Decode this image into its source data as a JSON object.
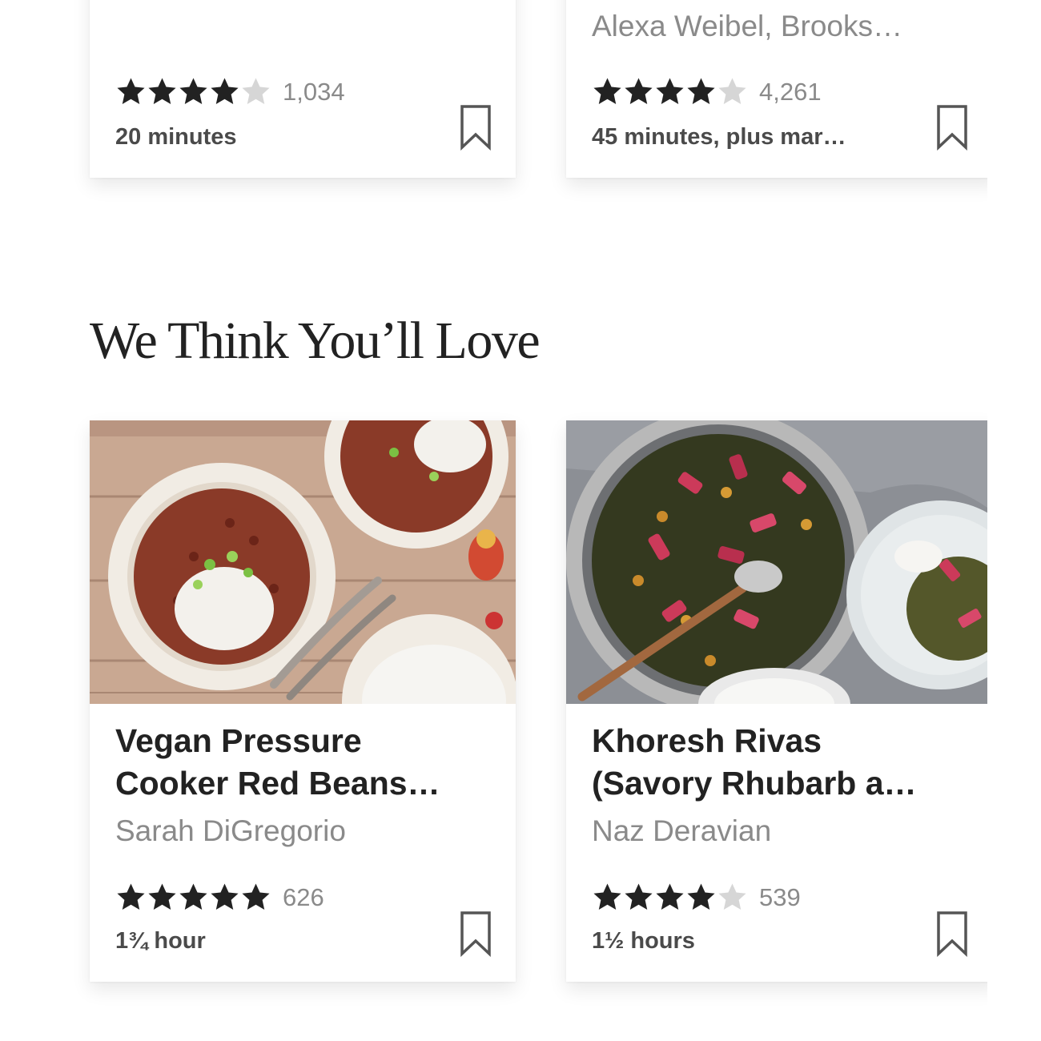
{
  "section": {
    "heading": "We Think You’ll Love"
  },
  "top_cards": [
    {
      "author": "",
      "stars": 4,
      "rating_count": "1,034",
      "time": "20 minutes"
    },
    {
      "author": "Alexa Weibel, Brooks…",
      "stars": 4,
      "rating_count": "4,261",
      "time": "45 minutes, plus mar…"
    }
  ],
  "recipes": [
    {
      "title_line1": "Vegan Pressure",
      "title_line2": "Cooker Red Beans…",
      "author": "Sarah DiGregorio",
      "stars": 5,
      "rating_count": "626",
      "time": "1¾ hour"
    },
    {
      "title_line1": "Khoresh Rivas",
      "title_line2": "(Savory Rhubarb a…",
      "author": "Naz Deravian",
      "stars": 4,
      "rating_count": "539",
      "time": "1½ hours"
    }
  ],
  "colors": {
    "star_filled": "#222222",
    "star_empty": "#d6d6d6",
    "title": "#222222",
    "meta": "#8a8a8a"
  },
  "icons": {
    "star": "star-icon",
    "bookmark": "bookmark-icon"
  }
}
